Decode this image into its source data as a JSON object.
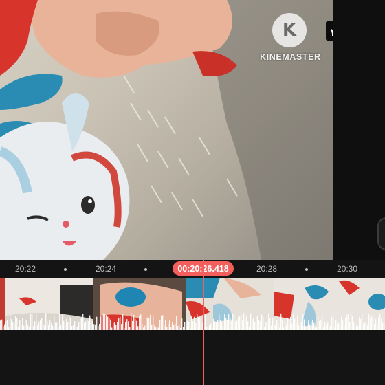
{
  "watermark": {
    "logo_letter": "K",
    "brand": "KINEMASTER",
    "crown_icon": "crown-icon"
  },
  "timeline": {
    "ticks": [
      "20:22",
      "20:24",
      "20:28",
      "20:30"
    ],
    "current_time": "00:20:26.418"
  },
  "colors": {
    "accent": "#f25f5c",
    "background": "#141414"
  }
}
